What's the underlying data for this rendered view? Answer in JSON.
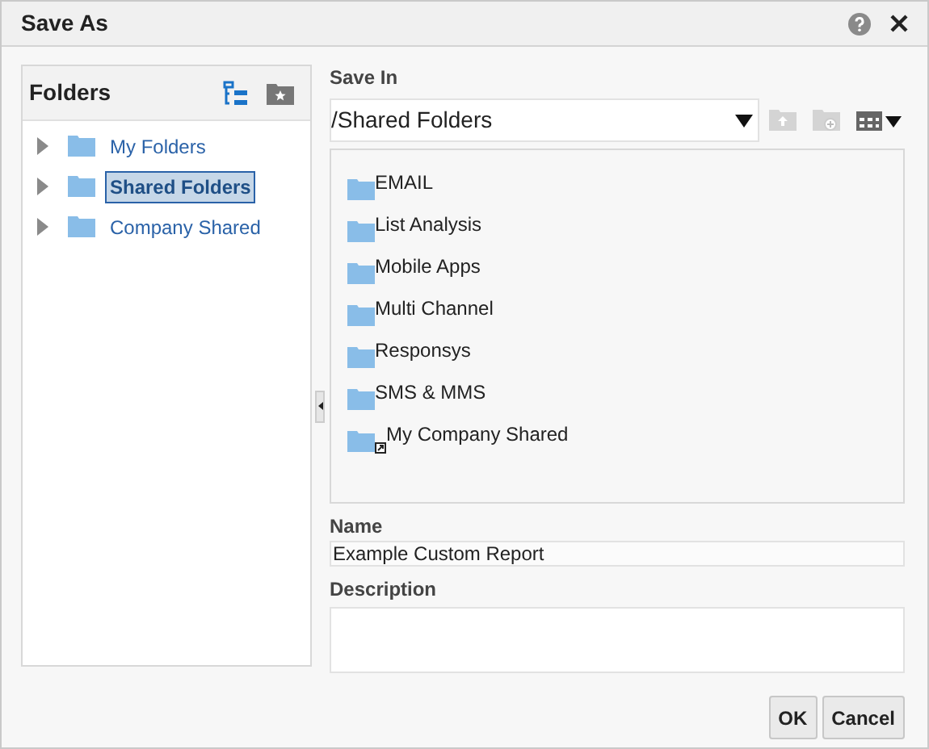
{
  "window": {
    "title": "Save As"
  },
  "folders_panel": {
    "title": "Folders",
    "items": [
      {
        "label": "My Folders",
        "selected": false
      },
      {
        "label": "Shared Folders",
        "selected": true
      },
      {
        "label": "Company Shared",
        "selected": false
      }
    ]
  },
  "save_in": {
    "label": "Save In",
    "value": "/Shared Folders"
  },
  "contents": [
    {
      "label": "EMAIL",
      "kind": "folder"
    },
    {
      "label": "List Analysis",
      "kind": "folder"
    },
    {
      "label": "Mobile Apps",
      "kind": "folder"
    },
    {
      "label": "Multi Channel",
      "kind": "folder"
    },
    {
      "label": "Responsys",
      "kind": "folder"
    },
    {
      "label": "SMS & MMS",
      "kind": "folder"
    },
    {
      "label": "My Company Shared",
      "kind": "shortcut"
    }
  ],
  "name": {
    "label": "Name",
    "value": "Example Custom Report"
  },
  "description": {
    "label": "Description"
  },
  "buttons": [
    "OK",
    "Cancel"
  ]
}
